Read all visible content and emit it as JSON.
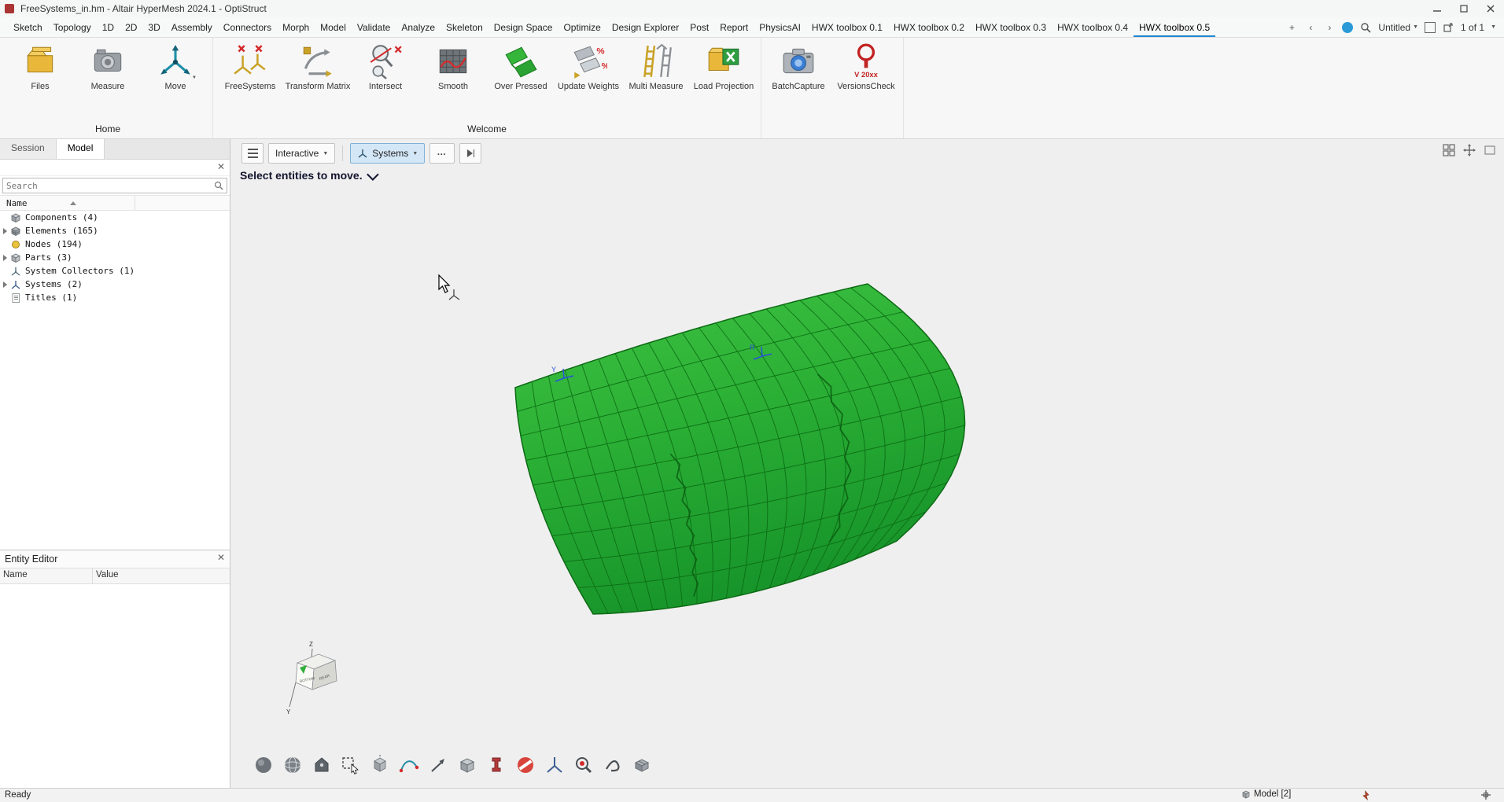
{
  "window": {
    "title": "FreeSystems_in.hm - Altair HyperMesh 2024.1 - OptiStruct"
  },
  "menubar": {
    "items": [
      "Sketch",
      "Topology",
      "1D",
      "2D",
      "3D",
      "Assembly",
      "Connectors",
      "Morph",
      "Model",
      "Validate",
      "Analyze",
      "Skeleton",
      "Design Space",
      "Optimize",
      "Design Explorer",
      "Post",
      "Report",
      "PhysicsAI",
      "HWX toolbox 0.1",
      "HWX toolbox 0.2",
      "HWX toolbox 0.3",
      "HWX toolbox 0.4",
      "HWX toolbox 0.5"
    ],
    "active_item": "HWX toolbox 0.5",
    "right": {
      "document_name": "Untitled",
      "page_indicator": "1 of 1"
    }
  },
  "ribbon": {
    "groups": [
      {
        "label": "Home",
        "items": [
          {
            "label": "Files",
            "icon": "files-icon"
          },
          {
            "label": "Measure",
            "icon": "measure-icon"
          },
          {
            "label": "Move",
            "icon": "move-icon",
            "has_dropdown": true
          }
        ]
      },
      {
        "label": "Welcome",
        "items": [
          {
            "label": "FreeSystems",
            "icon": "freesystems-icon"
          },
          {
            "label": "Transform Matrix",
            "icon": "transform-matrix-icon"
          },
          {
            "label": "Intersect",
            "icon": "intersect-icon"
          },
          {
            "label": "Smooth",
            "icon": "smooth-icon"
          },
          {
            "label": "Over Pressed",
            "icon": "over-pressed-icon"
          },
          {
            "label": "Update Weights",
            "icon": "update-weights-icon"
          },
          {
            "label": "Multi Measure",
            "icon": "multi-measure-icon"
          },
          {
            "label": "Load Projection",
            "icon": "load-projection-icon"
          }
        ]
      },
      {
        "label": "",
        "items": [
          {
            "label": "BatchCapture",
            "icon": "batchcapture-icon"
          },
          {
            "label": "VersionsCheck",
            "icon": "versionscheck-icon",
            "icon_text": "V 20xx"
          }
        ]
      }
    ]
  },
  "browser": {
    "tabs": [
      {
        "label": "Session"
      },
      {
        "label": "Model"
      }
    ],
    "active_tab": "Model",
    "search_placeholder": "Search",
    "name_column": "Name",
    "tree": [
      {
        "label": "Components (4)",
        "icon": "components-icon",
        "expandable": false
      },
      {
        "label": "Elements (165)",
        "icon": "elements-icon",
        "expandable": true
      },
      {
        "label": "Nodes (194)",
        "icon": "nodes-icon",
        "expandable": false
      },
      {
        "label": "Parts (3)",
        "icon": "parts-icon",
        "expandable": true
      },
      {
        "label": "System Collectors (1)",
        "icon": "system-collectors-icon",
        "expandable": false
      },
      {
        "label": "Systems (2)",
        "icon": "systems-icon",
        "expandable": true
      },
      {
        "label": "Titles (1)",
        "icon": "titles-icon",
        "expandable": false
      }
    ]
  },
  "entity_editor": {
    "title": "Entity Editor",
    "columns": [
      "Name",
      "Value"
    ]
  },
  "viewport": {
    "toolbar": {
      "mode_label": "Interactive",
      "tool_label": "Systems"
    },
    "prompt": "Select entities to move.",
    "markers": [
      {
        "label": "Y"
      },
      {
        "label": "R"
      }
    ],
    "view_cube": {
      "axis_top": "Z",
      "axis_bottom": "Y",
      "face_right": "REAR",
      "face_front": "BOTTOM"
    },
    "bottom_tools": [
      {
        "icon": "shaded-sphere-icon"
      },
      {
        "icon": "wireframe-globe-icon"
      },
      {
        "icon": "entity-tag-icon"
      },
      {
        "icon": "area-select-icon"
      },
      {
        "icon": "move-box-icon"
      },
      {
        "icon": "edit-curve-icon"
      },
      {
        "icon": "vector-tool-icon"
      },
      {
        "icon": "solid-block-icon"
      },
      {
        "icon": "beam-section-icon"
      },
      {
        "icon": "mask-icon"
      },
      {
        "icon": "systems-triad-icon"
      },
      {
        "icon": "search-entities-icon"
      },
      {
        "icon": "morph-tool-icon"
      },
      {
        "icon": "geometry-block-icon"
      }
    ]
  },
  "statusbar": {
    "ready": "Ready",
    "model_badge": "Model [2]"
  },
  "colors": {
    "mesh_fill_light": "#41c445",
    "mesh_fill_mid": "#2cb136",
    "mesh_fill_dark": "#17942a",
    "mesh_line": "#0b6b12",
    "marker_blue": "#2a52d8",
    "accent_blue": "#1e88d2"
  }
}
